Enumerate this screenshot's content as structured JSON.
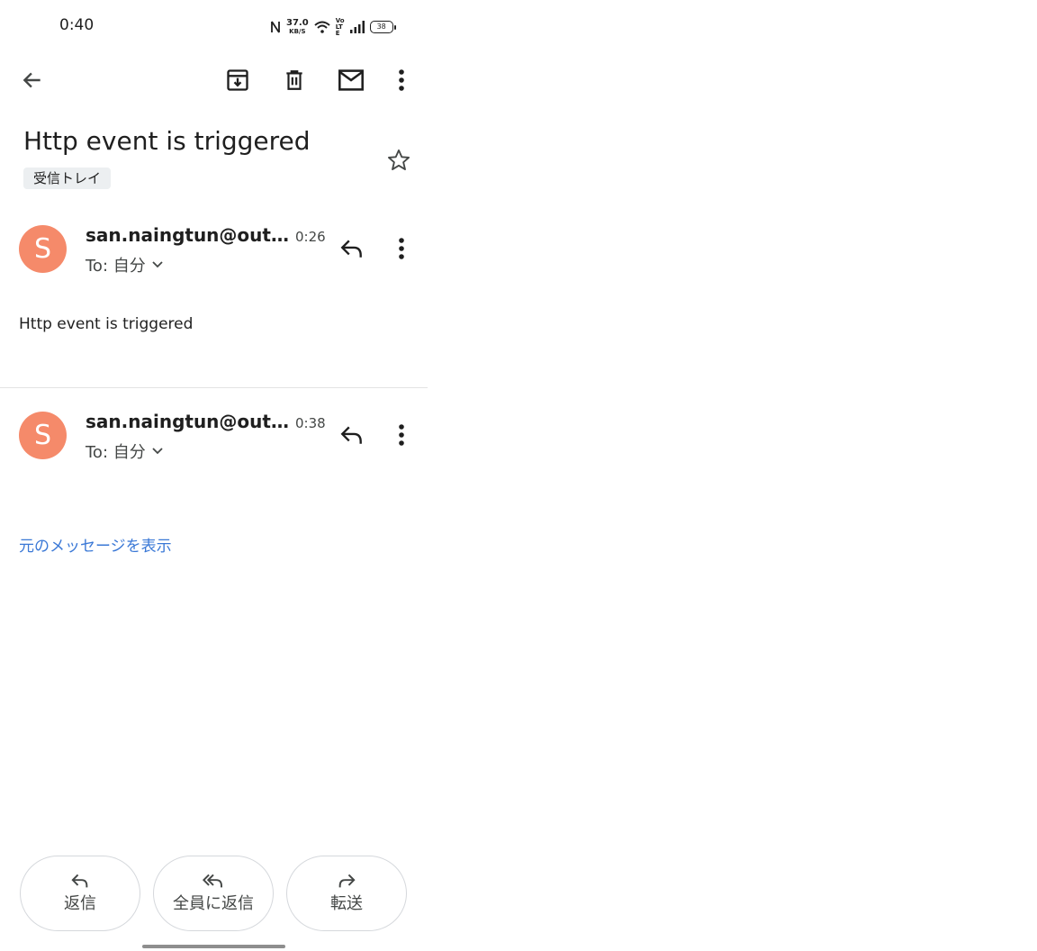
{
  "status_bar": {
    "time": "0:40",
    "net_speed_value": "37.0",
    "net_speed_unit": "KB/S",
    "volte": "Vo LTE",
    "battery": "38"
  },
  "toolbar": {
    "back_icon": "arrow-left-icon",
    "archive_icon": "archive-icon",
    "delete_icon": "trash-icon",
    "mark_unread_icon": "mail-icon",
    "more_icon": "more-vert-icon"
  },
  "thread": {
    "subject": "Http event is triggered",
    "label": "受信トレイ",
    "star_icon": "star-outline-icon"
  },
  "messages": [
    {
      "avatar_letter": "S",
      "sender": "san.naingtun@outlook.com",
      "time": "0:26",
      "to": "To: 自分",
      "body": "Http event is triggered"
    },
    {
      "avatar_letter": "S",
      "sender": "san.naingtun@outlook.com",
      "time": "0:38",
      "to": "To: 自分"
    }
  ],
  "show_original": "元のメッセージを表示",
  "actions": {
    "reply": "返信",
    "reply_all": "全員に返信",
    "forward": "転送"
  },
  "colors": {
    "avatar": "#f58a6a",
    "link": "#3a78d6",
    "chip": "#eceff1"
  }
}
